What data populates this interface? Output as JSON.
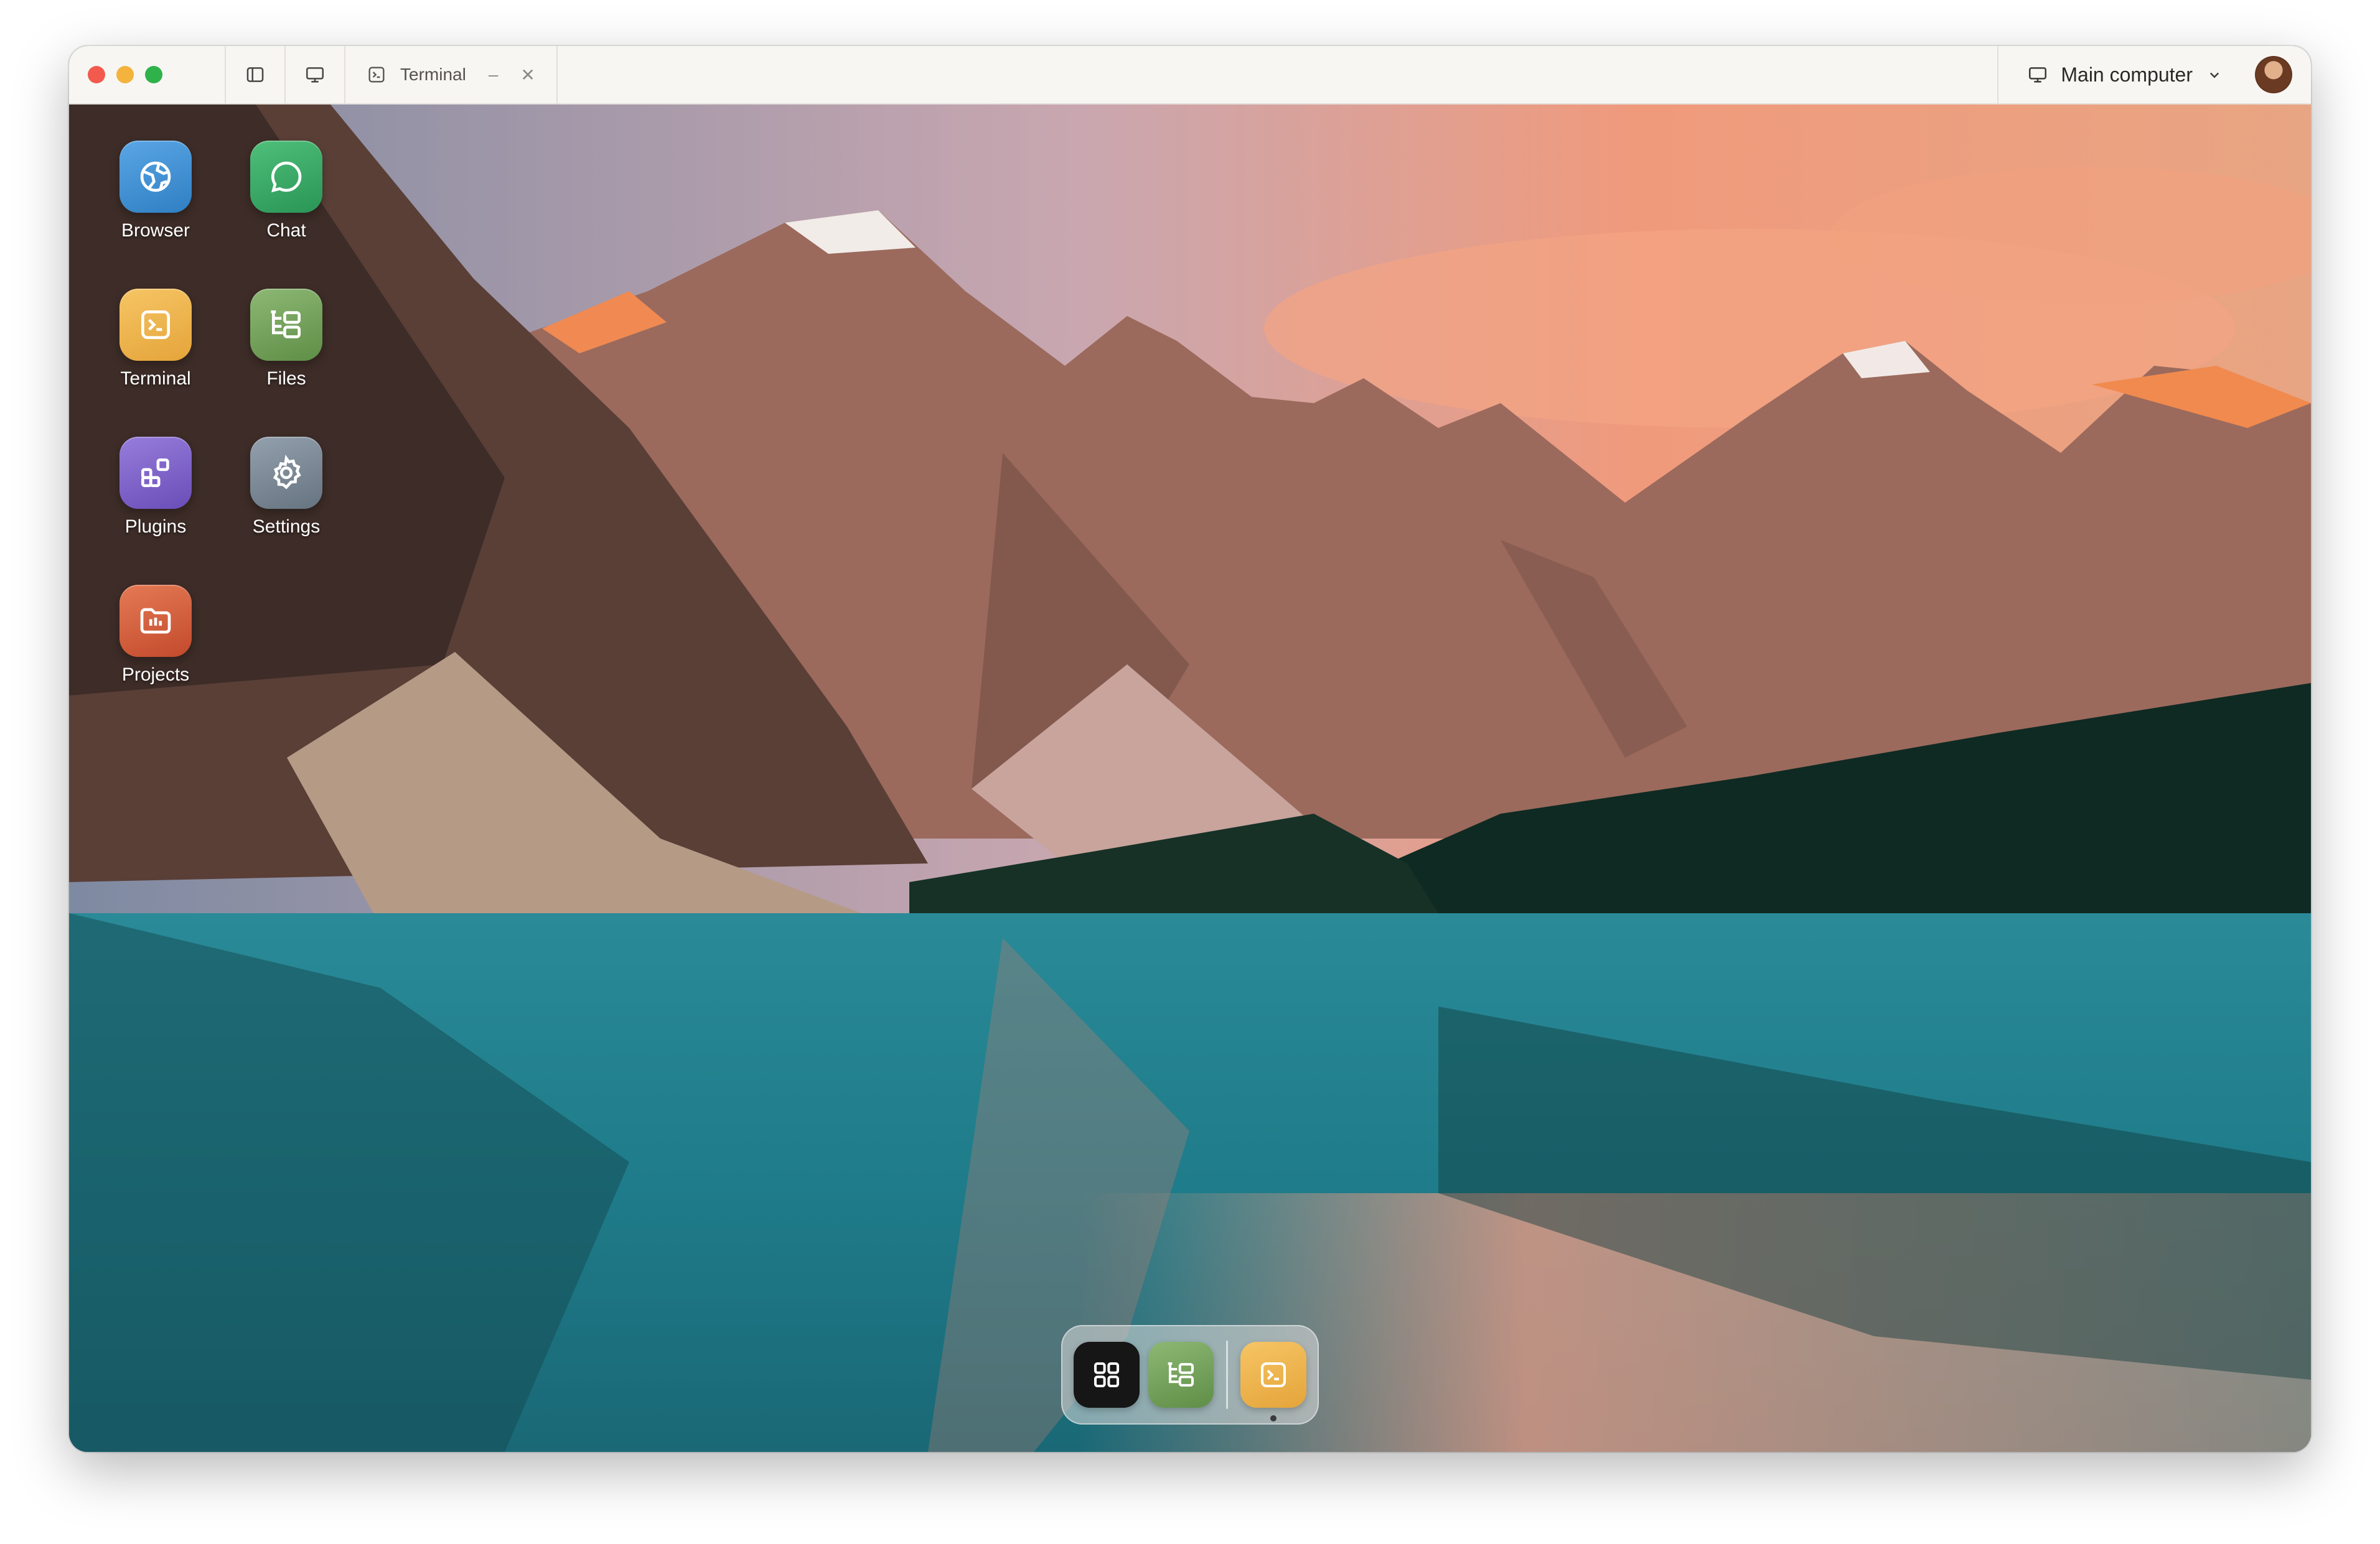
{
  "window": {
    "tab": {
      "label": "Terminal",
      "icon": "terminal-icon"
    },
    "machine_selector": {
      "label": "Main computer",
      "icon": "monitor-icon"
    }
  },
  "desktop_icons": [
    {
      "label": "Browser",
      "icon": "globe-icon",
      "color": "#3d8fd1"
    },
    {
      "label": "Chat",
      "icon": "chat-bubble-icon",
      "color": "#36a563"
    },
    {
      "label": "Terminal",
      "icon": "terminal-icon",
      "color": "#efb548"
    },
    {
      "label": "Files",
      "icon": "folder-tree-icon",
      "color": "#73a05a"
    },
    {
      "label": "Plugins",
      "icon": "plugin-blocks-icon",
      "color": "#7e62c9"
    },
    {
      "label": "Settings",
      "icon": "gear-icon",
      "color": "#7a8794"
    },
    {
      "label": "Projects",
      "icon": "projects-folder-icon",
      "color": "#d65c3b"
    }
  ],
  "dock": {
    "items": [
      {
        "icon": "app-grid-icon",
        "color": "#161616"
      },
      {
        "icon": "folder-tree-icon",
        "color": "#73a05a"
      },
      {
        "icon": "terminal-icon",
        "color": "#efb548",
        "running": true
      }
    ]
  },
  "colors": {
    "titlebar": "#f7f6f3",
    "close": "#f25a4e",
    "minimize": "#f3b33c",
    "maximize": "#2fb24a"
  }
}
